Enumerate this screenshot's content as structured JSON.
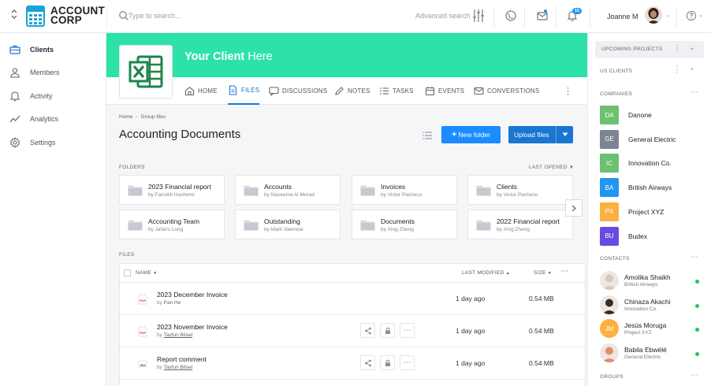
{
  "app": {
    "logo_text_line1": "ACCOUNT",
    "logo_text_line2": "CORP",
    "collapse_icon": "chevron-up-down-icon"
  },
  "topbar": {
    "search_placeholder": "Type to search...",
    "advanced_search_label": "Advanced search",
    "notification_count": "15",
    "user_name": "Joanne M"
  },
  "nav": {
    "items": [
      {
        "label": "Clients",
        "icon": "briefcase-icon",
        "active": true
      },
      {
        "label": "Members",
        "icon": "user-icon",
        "active": false
      },
      {
        "label": "Activity",
        "icon": "bell-icon",
        "active": false
      },
      {
        "label": "Analytics",
        "icon": "chart-line-icon",
        "active": false
      },
      {
        "label": "Settings",
        "icon": "gear-icon",
        "active": false
      }
    ]
  },
  "client": {
    "title_bold": "Your Client",
    "title_rest": " Here",
    "banner_color": "#2de2a8"
  },
  "tabs": [
    {
      "label": "HOME",
      "icon": "home-icon"
    },
    {
      "label": "FILES",
      "icon": "file-icon"
    },
    {
      "label": "DISCUSSIONS",
      "icon": "chat-icon"
    },
    {
      "label": "NOTES",
      "icon": "pencil-icon"
    },
    {
      "label": "TASKS",
      "icon": "checklist-icon"
    },
    {
      "label": "EVENTS",
      "icon": "calendar-icon"
    },
    {
      "label": "CONVERSTIONS",
      "icon": "mail-icon"
    }
  ],
  "page": {
    "breadcrumb_home": "Home",
    "breadcrumb_current": "Group files",
    "title": "Accounting Documents",
    "new_folder_label": "New folder",
    "upload_label": "Upload files",
    "folders_label": "FOLDERS",
    "last_opened_label": "LAST OPENED",
    "files_label": "FILES"
  },
  "folders": [
    {
      "name": "2023 Financial report",
      "by": "by Farrokh Hashemi"
    },
    {
      "name": "Accounts",
      "by": "by Naseema Al Morad"
    },
    {
      "name": "Invoices",
      "by": "by Victor Pacheco"
    },
    {
      "name": "Clients",
      "by": "by Victor Pacheco"
    },
    {
      "name": "Accounting Team",
      "by": "by Jafaris Long"
    },
    {
      "name": "Outstanding",
      "by": "by Marti Valencia"
    },
    {
      "name": "Documents",
      "by": "by Xing Zheng"
    },
    {
      "name": "2022 Financial report",
      "by": "by Xing Zheng"
    }
  ],
  "files_table": {
    "col_name": "NAME",
    "col_modified": "LAST MODIFIED",
    "col_size": "SIZE",
    "rows": [
      {
        "name": "2023 December Invoice",
        "by_prefix": "by ",
        "by": "Pan He",
        "modified": "1 day ago",
        "size": "0.54 MB",
        "type": "pdf",
        "icon_label": "PDF"
      },
      {
        "name": "2023 November Invoice",
        "by_prefix": "by ",
        "by": "Tayfun Bilsel",
        "modified": "1 day ago",
        "size": "0.54 MB",
        "type": "pdf",
        "icon_label": "PDF"
      },
      {
        "name": "Report comment",
        "by_prefix": "by ",
        "by": "Tayfun Bilsel",
        "modified": "1 day ago",
        "size": "0.54 MB",
        "type": "image"
      }
    ]
  },
  "right_panel": {
    "upcoming_label": "UPCOMING PROJECTS",
    "us_clients_label": "US CLIENTS",
    "companies_label": "COMPANIES",
    "contacts_label": "CONTACTS",
    "groups_label": "GROUPS",
    "companies": [
      {
        "initials": "DA",
        "name": "Danone",
        "color": "#6cc070"
      },
      {
        "initials": "GE",
        "name": "General Electric",
        "color": "#7c8494"
      },
      {
        "initials": "IC",
        "name": "Innovation Co.",
        "color": "#6cc070"
      },
      {
        "initials": "BA",
        "name": "British Airways",
        "color": "#2196f3"
      },
      {
        "initials": "PX",
        "name": "Project XYZ",
        "color": "#fbb040"
      },
      {
        "initials": "BU",
        "name": "Budex",
        "color": "#6a4be0"
      }
    ],
    "contacts": [
      {
        "name": "Amolika Shaikh",
        "company": "British Airways",
        "avatar": "photo",
        "color": "#d9c7bd"
      },
      {
        "name": "Chinaza Akachi",
        "company": "Innovation Co.",
        "avatar": "photo",
        "color": "#3b2b24"
      },
      {
        "name": "Jesús Moruga",
        "company": "Project XYZ",
        "avatar": "initials",
        "initials": "JM",
        "color": "#fbb040"
      },
      {
        "name": "Babila Ebwélé",
        "company": "General Electric",
        "avatar": "photo",
        "color": "#e58b6b"
      }
    ]
  }
}
